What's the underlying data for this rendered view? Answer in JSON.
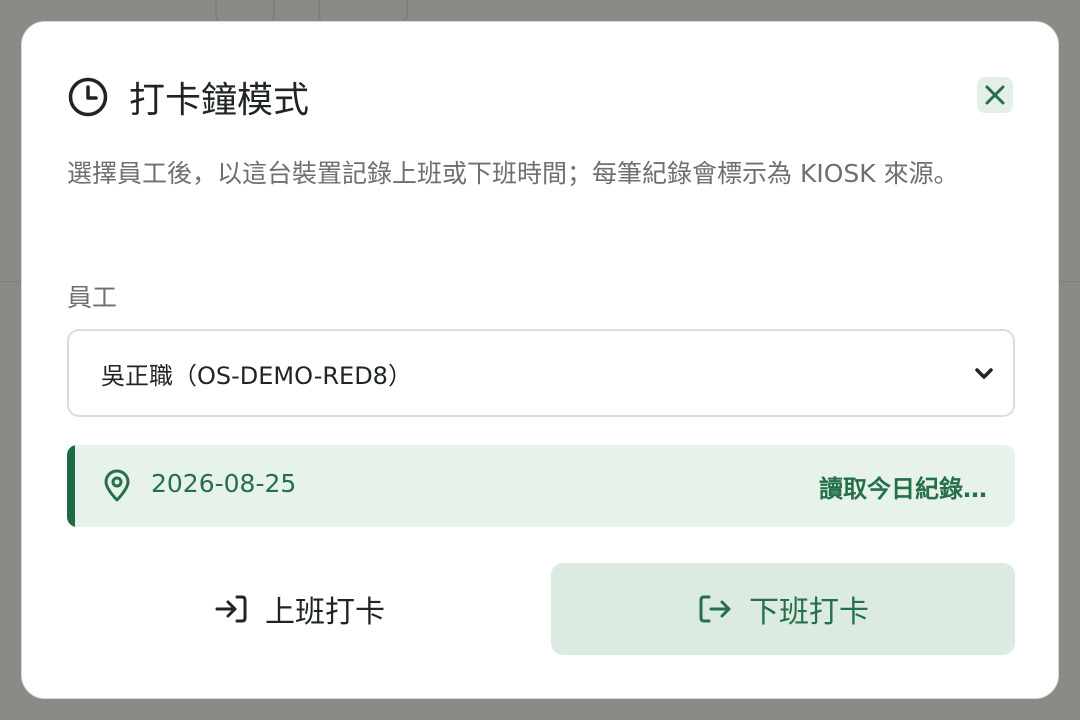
{
  "modal": {
    "title": "打卡鐘模式",
    "title_icon": "clock-icon",
    "close_icon": "close-icon",
    "description": "選擇員工後，以這台裝置記錄上班或下班時間；每筆紀錄會標示為 KIOSK 來源。",
    "employee_label": "員工",
    "employee_selected": "吳正職（OS-DEMO-RED8）",
    "info": {
      "date": "2026-08-25",
      "status": "讀取今日紀錄…",
      "icon": "location-pin-icon"
    },
    "buttons": {
      "clock_in_label": "上班打卡",
      "clock_in_icon": "login-icon",
      "clock_out_label": "下班打卡",
      "clock_out_icon": "logout-icon"
    }
  },
  "colors": {
    "accent": "#1f6a45",
    "accent_text": "#266f4b",
    "accent_bg": "#e6f2ea",
    "button_active_bg": "#dcebe1"
  }
}
